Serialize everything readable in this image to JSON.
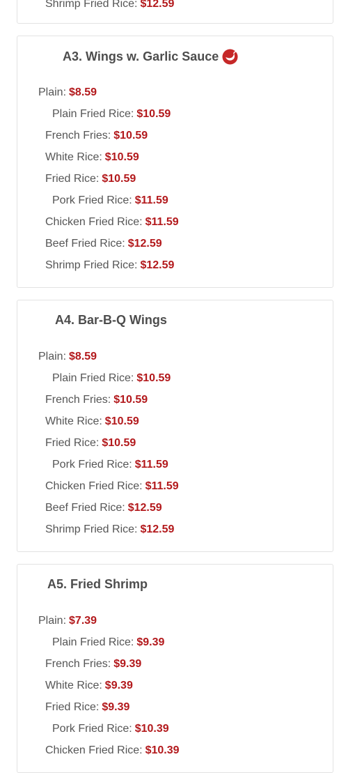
{
  "colors": {
    "price": "#b3191c",
    "text": "#555555",
    "title": "#4d4d4d",
    "border": "#e2e2e2"
  },
  "top_partial": {
    "label": "Shrimp Fried Rice:",
    "price": "$12.59"
  },
  "items": [
    {
      "title": "A3. Wings w. Garlic Sauce",
      "icon": "hot-pepper-icon",
      "options": [
        {
          "label": "Plain:",
          "price": "$8.59"
        },
        {
          "label": "Plain Fried Rice:",
          "price": "$10.59"
        },
        {
          "label": "French Fries:",
          "price": "$10.59"
        },
        {
          "label": "White Rice:",
          "price": "$10.59"
        },
        {
          "label": "Fried Rice:",
          "price": "$10.59"
        },
        {
          "label": "Pork Fried Rice:",
          "price": "$11.59"
        },
        {
          "label": "Chicken Fried Rice:",
          "price": "$11.59"
        },
        {
          "label": "Beef Fried Rice:",
          "price": "$12.59"
        },
        {
          "label": "Shrimp Fried Rice:",
          "price": "$12.59"
        }
      ]
    },
    {
      "title": "A4. Bar-B-Q Wings",
      "options": [
        {
          "label": "Plain:",
          "price": "$8.59"
        },
        {
          "label": "Plain Fried Rice:",
          "price": "$10.59"
        },
        {
          "label": "French Fries:",
          "price": "$10.59"
        },
        {
          "label": "White Rice:",
          "price": "$10.59"
        },
        {
          "label": "Fried Rice:",
          "price": "$10.59"
        },
        {
          "label": "Pork Fried Rice:",
          "price": "$11.59"
        },
        {
          "label": "Chicken Fried Rice:",
          "price": "$11.59"
        },
        {
          "label": "Beef Fried Rice:",
          "price": "$12.59"
        },
        {
          "label": "Shrimp Fried Rice:",
          "price": "$12.59"
        }
      ]
    },
    {
      "title": "A5. Fried Shrimp",
      "options": [
        {
          "label": "Plain:",
          "price": "$7.39"
        },
        {
          "label": "Plain Fried Rice:",
          "price": "$9.39"
        },
        {
          "label": "French Fries:",
          "price": "$9.39"
        },
        {
          "label": "White Rice:",
          "price": "$9.39"
        },
        {
          "label": "Fried Rice:",
          "price": "$9.39"
        },
        {
          "label": "Pork Fried Rice:",
          "price": "$10.39"
        },
        {
          "label": "Chicken Fried Rice:",
          "price": "$10.39"
        }
      ]
    }
  ]
}
